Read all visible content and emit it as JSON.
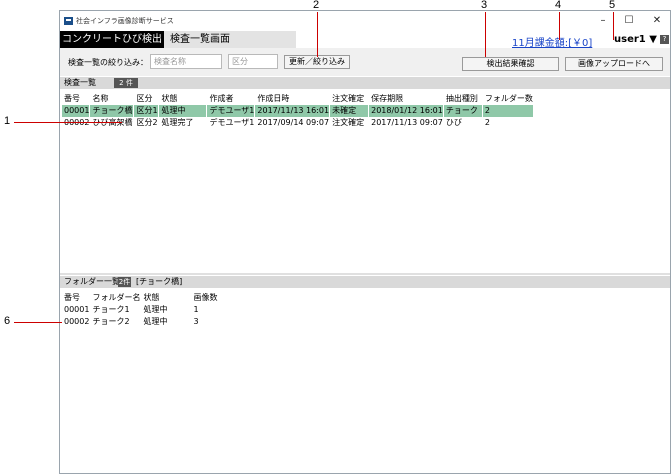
{
  "callouts": [
    "1",
    "2",
    "3",
    "4",
    "5",
    "6"
  ],
  "window": {
    "title": "社会インフラ画像診断サービス",
    "controls": {
      "minimize": "–",
      "maximize": "☐",
      "close": "✕"
    }
  },
  "menubar": {
    "app_name": "コンクリートひび検出",
    "screen_title": "検査一覧画面",
    "billing": "11月課金額:[￥0]",
    "user": "user1 ▼",
    "help": "?"
  },
  "filter": {
    "label": "検査一覧の絞り込み：",
    "name_placeholder": "検査名称",
    "category_placeholder": "区分",
    "refresh_button": "更新／絞り込み",
    "results_button": "検出結果確認",
    "upload_button": "画像アップロードへ"
  },
  "inspection_list": {
    "header": "検査一覧",
    "count": "2 件",
    "columns": [
      "番号",
      "名称",
      "区分",
      "状態",
      "作成者",
      "作成日時",
      "注文確定",
      "保存期限",
      "抽出種別",
      "フォルダー数"
    ],
    "rows": [
      [
        "00001",
        "チョーク橋",
        "区分1",
        "処理中",
        "デモユーザ1",
        "2017/11/13 16:01",
        "未確定",
        "2018/01/12 16:01",
        "チョーク",
        "2"
      ],
      [
        "00002",
        "ひび高架橋",
        "区分2",
        "処理完了",
        "デモユーザ1",
        "2017/09/14 09:07",
        "注文確定",
        "2017/11/13 09:07",
        "ひび",
        "2"
      ]
    ]
  },
  "folder_list": {
    "header": "フォルダー一覧",
    "count": "2件",
    "context": "[チョーク橋]",
    "columns": [
      "番号",
      "フォルダー名",
      "状態",
      "画像数"
    ],
    "rows": [
      [
        "00001",
        "チョーク1",
        "処理中",
        "1"
      ],
      [
        "00002",
        "チョーク2",
        "処理中",
        "3"
      ]
    ]
  },
  "colors": {
    "selected_row": "#8fc8a8",
    "callout_line": "#cc0000",
    "billing_link": "#1a45c8"
  }
}
